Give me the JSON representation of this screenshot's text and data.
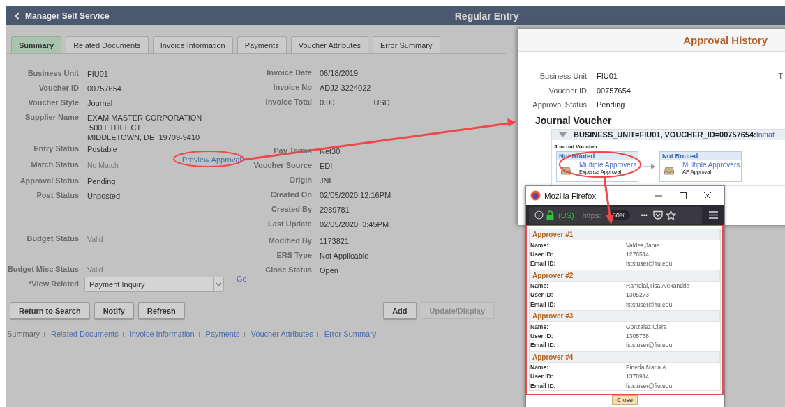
{
  "header": {
    "back_label": "Manager Self Service",
    "title": "Regular Entry"
  },
  "tabs": [
    {
      "label": "Summary",
      "selected": true
    },
    {
      "label": "Related Documents",
      "selected": false
    },
    {
      "label": "Invoice Information",
      "selected": false
    },
    {
      "label": "Payments",
      "selected": false
    },
    {
      "label": "Voucher Attributes",
      "selected": false
    },
    {
      "label": "Error Summary",
      "selected": false
    }
  ],
  "left_fields": [
    {
      "label": "Business Unit",
      "lines": [
        "FIU01"
      ],
      "muted": false
    },
    {
      "label": "Voucher ID",
      "lines": [
        "00757654"
      ],
      "muted": false
    },
    {
      "label": "Voucher Style",
      "lines": [
        "Journal"
      ],
      "muted": false
    },
    {
      "label": "Supplier Name",
      "lines": [
        "EXAM MASTER CORPORATION",
        " 500 ETHEL CT",
        "MIDDLETOWN, DE  19709-9410"
      ],
      "muted": false
    },
    {
      "label": "Entry Status",
      "lines": [
        "Postable"
      ],
      "muted": false
    },
    {
      "label": "Match Status",
      "lines": [
        "No Match"
      ],
      "muted": true
    },
    {
      "label": "Approval Status",
      "lines": [
        "Pending"
      ],
      "muted": false
    },
    {
      "label": "Post Status",
      "lines": [
        "Unposted"
      ],
      "muted": false
    },
    {
      "label": "Budget Status",
      "lines": [
        "Valid"
      ],
      "muted": true
    },
    {
      "label": "Budget Misc Status",
      "lines": [
        "Valid"
      ],
      "muted": true
    }
  ],
  "preview_link": "Preview Approval",
  "right_fields": [
    {
      "label": "Invoice Date",
      "value": "06/18/2019"
    },
    {
      "label": "Invoice No",
      "value": "ADJ2-3224022"
    },
    {
      "label": "Invoice Total",
      "value": "0.00",
      "unit": "USD"
    },
    {
      "label": "Pay Terms",
      "value": "Net30"
    },
    {
      "label": "Voucher Source",
      "value": "EDI"
    },
    {
      "label": "Origin",
      "value": "JNL"
    },
    {
      "label": "Created On",
      "value": "02/05/2020 12:16PM"
    },
    {
      "label": "Created By",
      "value": "2989781"
    },
    {
      "label": "Last Update",
      "value": "02/05/2020  3:45PM"
    },
    {
      "label": "Modified By",
      "value": "1173821"
    },
    {
      "label": "ERS Type",
      "value": "Not Applicable"
    },
    {
      "label": "Close Status",
      "value": "Open"
    }
  ],
  "view_related": {
    "label": "*View Related",
    "value": "Payment Inquiry",
    "go": "Go"
  },
  "buttons_left": [
    {
      "label": "Return to Search",
      "disabled": false
    },
    {
      "label": "Notify",
      "disabled": false
    },
    {
      "label": "Refresh",
      "disabled": false
    }
  ],
  "buttons_right": [
    {
      "label": "Add",
      "disabled": false
    },
    {
      "label": "Update/Display",
      "disabled": true
    }
  ],
  "footer_links": [
    {
      "label": "Summary",
      "selected": true
    },
    {
      "label": "Related Documents",
      "selected": false
    },
    {
      "label": "Invoice Information",
      "selected": false
    },
    {
      "label": "Payments",
      "selected": false
    },
    {
      "label": "Voucher Attributes",
      "selected": false
    },
    {
      "label": "Error Summary",
      "selected": false
    }
  ],
  "approval_history": {
    "title": "Approval History",
    "cut_label": "T",
    "fields": [
      {
        "label": "Business Unit",
        "value": "FIU01"
      },
      {
        "label": "Voucher ID",
        "value": "00757654"
      },
      {
        "label": "Approval Status",
        "value": "Pending"
      }
    ],
    "section_title": "Journal Voucher",
    "process": {
      "key": "BUSINESS_UNIT=FIU01, VOUCHER_ID=00757654:",
      "status": "Initiat",
      "subtitle": "Journal Voucher",
      "steps": [
        {
          "status": "Not Routed",
          "approver": "Multiple Approvers",
          "stage": "Expense Approval"
        },
        {
          "status": "Not Routed",
          "approver": "Multiple Approvers",
          "stage": "AP Approval"
        }
      ]
    }
  },
  "popup": {
    "title": "Mozilla Firefox",
    "region": "(US)",
    "url": "https:",
    "zoom": "80%",
    "more": "•••",
    "approvers": [
      {
        "title": "Approver #1",
        "rows": [
          {
            "label": "Name:",
            "value": "Valdes,Janie"
          },
          {
            "label": "User ID:",
            "value": "1276514"
          },
          {
            "label": "Email ID:",
            "value": "fststuser@fiu.edu"
          }
        ]
      },
      {
        "title": "Approver #2",
        "rows": [
          {
            "label": "Name:",
            "value": "Ramdial,Tisa Alexandria"
          },
          {
            "label": "User ID:",
            "value": "1305273"
          },
          {
            "label": "Email ID:",
            "value": "fststuser@fiu.edu"
          }
        ]
      },
      {
        "title": "Approver #3",
        "rows": [
          {
            "label": "Name:",
            "value": "Gonzalez,Clara"
          },
          {
            "label": "User ID:",
            "value": "1305738"
          },
          {
            "label": "Email ID:",
            "value": "fststuser@fiu.edu"
          }
        ]
      },
      {
        "title": "Approver #4",
        "rows": [
          {
            "label": "Name:",
            "value": "Pineda,Maria A"
          },
          {
            "label": "User ID:",
            "value": "1378914"
          },
          {
            "label": "Email ID:",
            "value": "fststuser@fiu.edu"
          }
        ]
      }
    ],
    "close": "Close"
  }
}
